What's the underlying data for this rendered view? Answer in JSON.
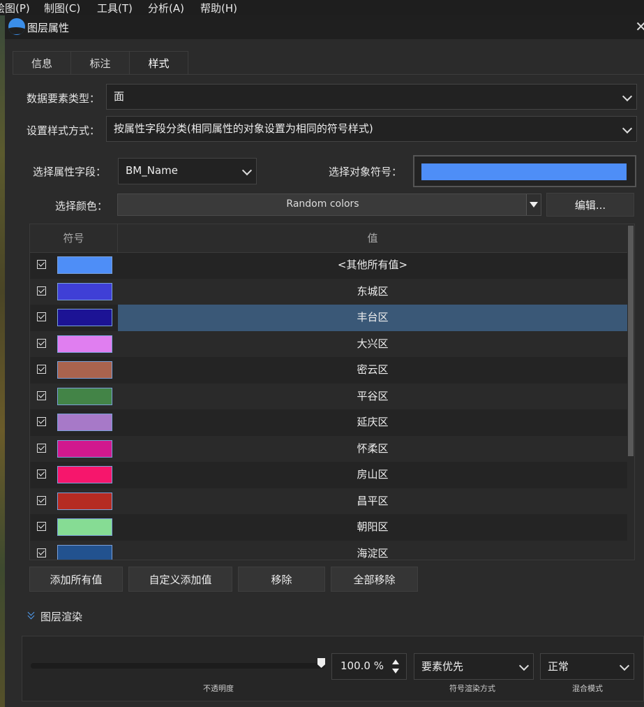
{
  "menubar": {
    "items": [
      "绘图(P)",
      "制图(C)",
      "工具(T)",
      "分析(A)",
      "帮助(H)"
    ]
  },
  "window": {
    "title": "图层属性"
  },
  "tabs": [
    {
      "label": "信息"
    },
    {
      "label": "标注"
    },
    {
      "label": "样式",
      "active": true
    }
  ],
  "form": {
    "data_type_label": "数据要素类型：",
    "data_type_value": "面",
    "style_mode_label": "设置样式方式：",
    "style_mode_value": "按属性字段分类(相同属性的对象设置为相同的符号样式)",
    "field_label": "选择属性字段：",
    "field_value": "BM_Name",
    "symbol_label": "选择对象符号：",
    "symbol_color": "#4e8ef7",
    "color_label": "选择颜色：",
    "color_value": "Random colors",
    "edit_button": "编辑..."
  },
  "table": {
    "header_symbol": "符号",
    "header_value": "值",
    "rows": [
      {
        "checked": true,
        "color": "#4e8ef7",
        "value": "<其他所有值>"
      },
      {
        "checked": true,
        "color": "#3f3fd6",
        "value": "东城区"
      },
      {
        "checked": true,
        "color": "#1c1395",
        "value": "丰台区",
        "selected": true
      },
      {
        "checked": true,
        "color": "#e07ef0",
        "value": "大兴区"
      },
      {
        "checked": true,
        "color": "#a9634e",
        "value": "密云区"
      },
      {
        "checked": true,
        "color": "#438447",
        "value": "平谷区"
      },
      {
        "checked": true,
        "color": "#a779c8",
        "value": "延庆区"
      },
      {
        "checked": true,
        "color": "#d1188e",
        "value": "怀柔区"
      },
      {
        "checked": true,
        "color": "#f6166c",
        "value": "房山区"
      },
      {
        "checked": true,
        "color": "#b52b22",
        "value": "昌平区"
      },
      {
        "checked": true,
        "color": "#86dc94",
        "value": "朝阳区"
      },
      {
        "checked": true,
        "color": "#22528f",
        "value": "海淀区"
      }
    ]
  },
  "buttons": {
    "add_all": "添加所有值",
    "custom_add": "自定义添加值",
    "remove": "移除",
    "remove_all": "全部移除"
  },
  "render": {
    "section_title": "图层渲染",
    "opacity_value": "100.0 %",
    "opacity_percent": 100,
    "opacity_label": "不透明度",
    "symbol_mode_value": "要素优先",
    "symbol_mode_label": "符号渲染方式",
    "blend_value": "正常",
    "blend_label": "混合模式"
  }
}
